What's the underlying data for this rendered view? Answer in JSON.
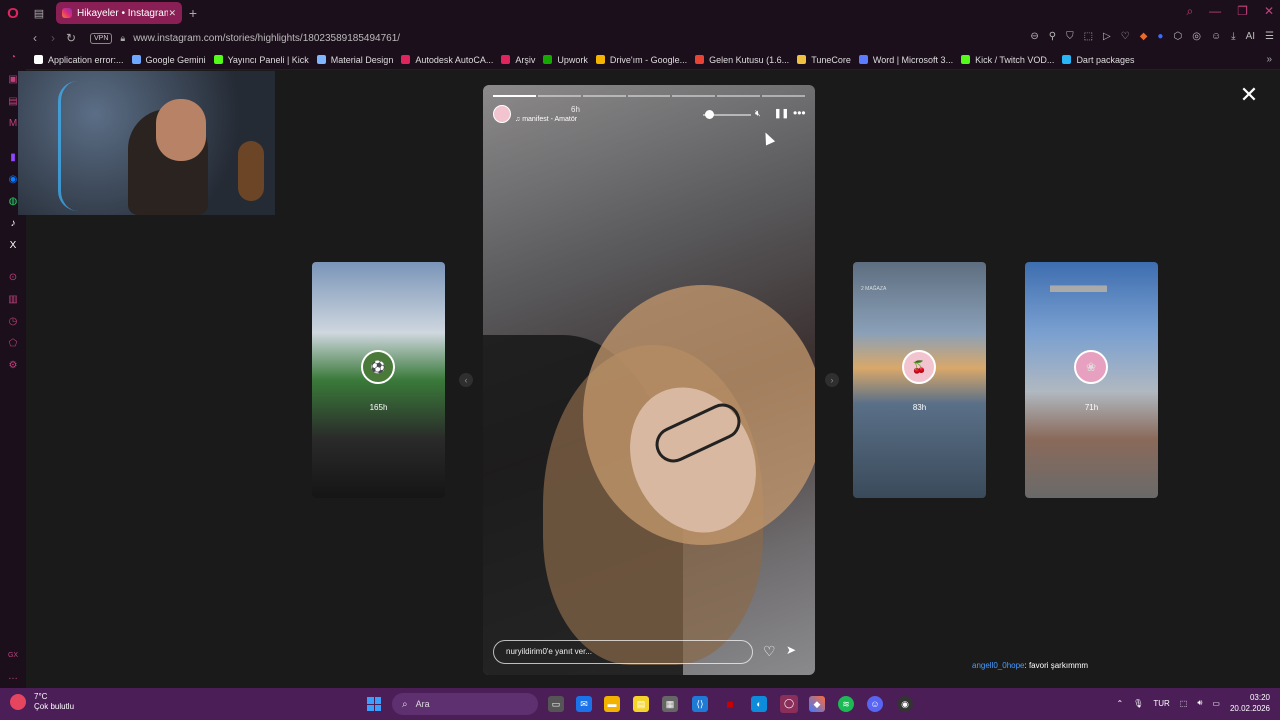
{
  "browser": {
    "tab_title": "Hikayeler • Instagram",
    "new_tab": "+",
    "url": "www.instagram.com/stories/highlights/18023589185494761/",
    "vpn_label": "VPN",
    "ai_label": "AI"
  },
  "bookmarks": [
    {
      "label": "Application error:...",
      "color": "#ffffff"
    },
    {
      "label": "Google Gemini",
      "color": "#6fa8ff"
    },
    {
      "label": "Yayıncı Paneli | Kick",
      "color": "#53fc18"
    },
    {
      "label": "Material Design",
      "color": "#7fb6ff"
    },
    {
      "label": "Autodesk AutoCA...",
      "color": "#e0245e"
    },
    {
      "label": "Arşiv",
      "color": "#e0245e"
    },
    {
      "label": "Upwork",
      "color": "#14a800"
    },
    {
      "label": "Drive'ım - Google...",
      "color": "#f4b400"
    },
    {
      "label": "Gelen Kutusu (1.6...",
      "color": "#ea4335"
    },
    {
      "label": "TuneCore",
      "color": "#f0c040"
    },
    {
      "label": "Word | Microsoft 3...",
      "color": "#5b7cff"
    },
    {
      "label": "Kick / Twitch VOD...",
      "color": "#53fc18"
    },
    {
      "label": "Dart packages",
      "color": "#29b6f6"
    }
  ],
  "story": {
    "time": "6h",
    "music": "manifest - Amatör",
    "reply_placeholder": "nuryildirim0'e yanıt ver...",
    "progress_total": 7,
    "progress_done": 1
  },
  "side_stories": [
    {
      "time": "165h",
      "icon": "⚽"
    },
    {
      "time": "83h",
      "icon": "🍒",
      "tag": "2 MAĞAZA"
    },
    {
      "time": "71h",
      "icon": "❀",
      "tag": "████████████████"
    }
  ],
  "chat": {
    "user": "angell0_0hope",
    "message": ": favori şarkımmm"
  },
  "taskbar": {
    "temperature": "7°C",
    "weather": "Çok bulutlu",
    "search": "Ara",
    "language": "TUR",
    "time": "03:20",
    "date": "20.02.2026"
  }
}
